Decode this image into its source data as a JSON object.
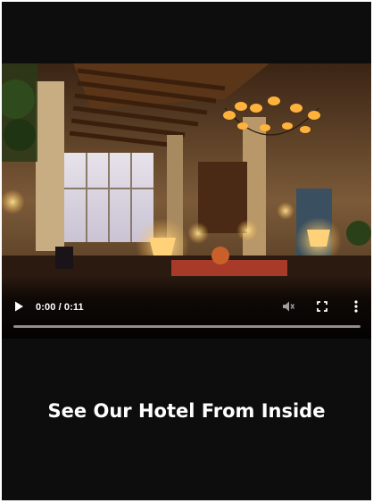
{
  "video_player": {
    "time_display": "0:00 / 0:11",
    "progress": 0.0,
    "controls": {
      "play_icon": "play-icon",
      "volume_icon": "volume-muted-icon",
      "fullscreen_icon": "fullscreen-icon",
      "menu_icon": "more-vertical-icon"
    }
  },
  "caption": {
    "title": "See Our Hotel From Inside"
  },
  "colors": {
    "background": "#0d0d0d",
    "text": "#ffffff",
    "control_icons_muted": "#9e9e9e"
  }
}
